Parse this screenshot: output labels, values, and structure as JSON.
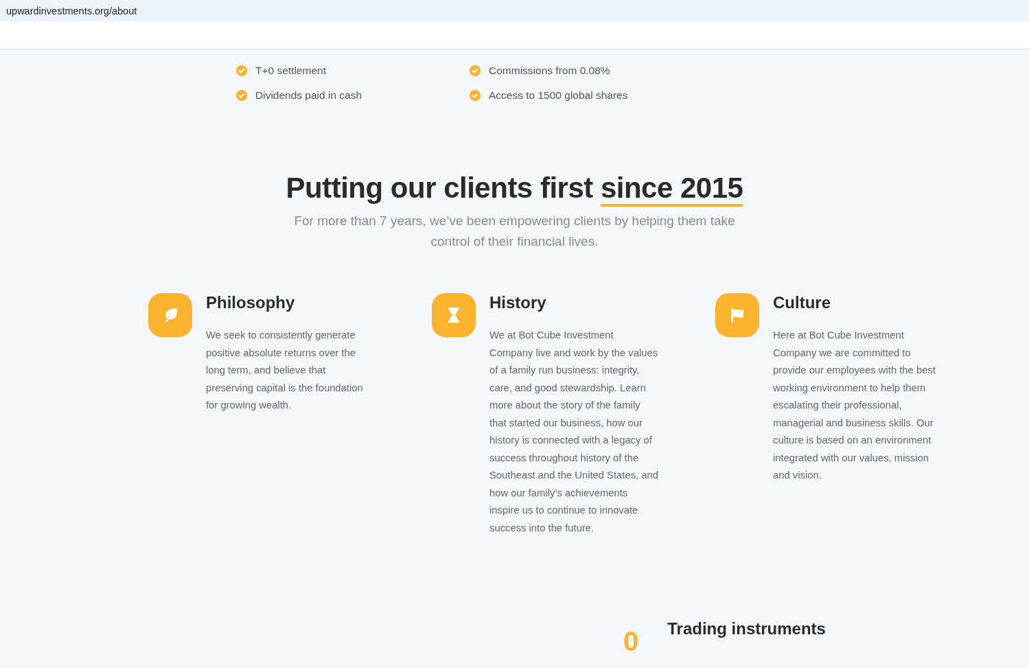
{
  "address_bar": {
    "url": "upwardinvestments.org/about"
  },
  "features_list": [
    {
      "label": "T+0 settlement"
    },
    {
      "label": "Commissions from 0.08%"
    },
    {
      "label": "Dividends paid in cash"
    },
    {
      "label": "Access to 1500 global shares"
    }
  ],
  "about": {
    "heading": "Putting our clients first",
    "heading_highlight": "since 2015",
    "subtitle": "For more than 7 years, we’ve been empowering clients by helping them take control of their financial lives."
  },
  "pillars": [
    {
      "kind": "leaf",
      "title": "Philosophy",
      "text": "We seek to consistently generate positive absolute returns over the long term, and believe that preserving capital is the foundation for growing wealth."
    },
    {
      "kind": "hourglass",
      "title": "History",
      "text": "We at Bot Cube Investment Company live and work by the values of a family run business: integrity, care, and good stewardship. Learn more about the story of the family that started our business, how our history is connected with a legacy of success throughout history of the Southeast and the United States, and how our family’s achievements inspire us to continue to innovate success into the future."
    },
    {
      "kind": "flag",
      "title": "Culture",
      "text": "Here at Bot Cube Investment Company we are committed to provide our employees with the best working environment to help them escalating their professional, managerial and business skills. Our culture is based on an environment integrated with our values, mission and vision."
    }
  ],
  "stats": [
    {
      "value": "0",
      "label": "Trading instruments"
    }
  ]
}
